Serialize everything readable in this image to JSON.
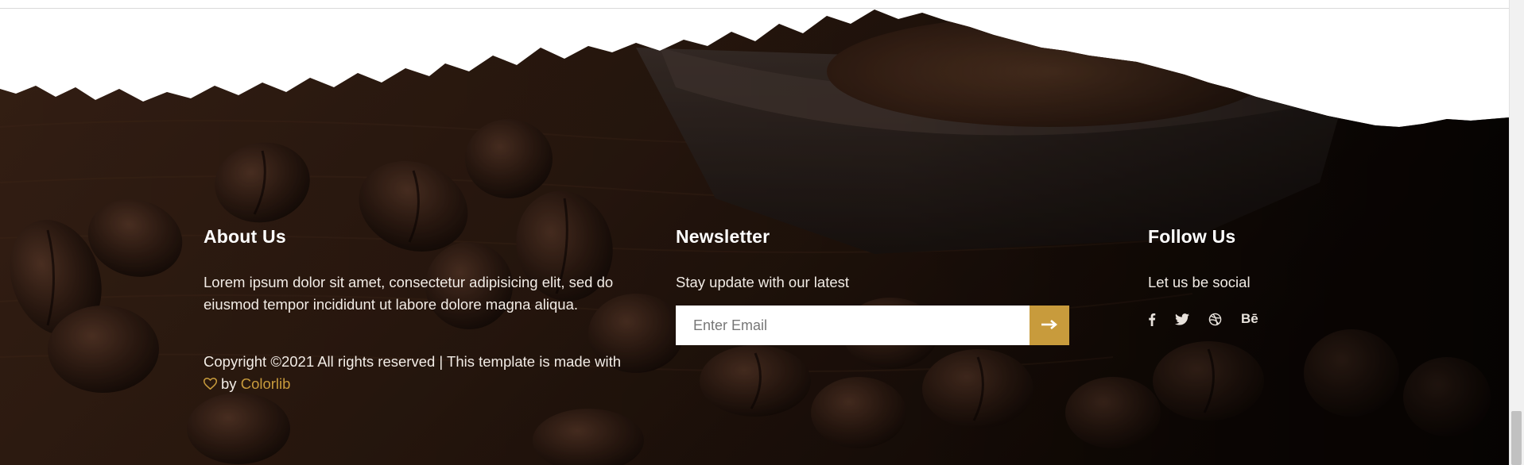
{
  "about": {
    "heading": "About Us",
    "text": "Lorem ipsum dolor sit amet, consectetur adipisicing elit, sed do eiusmod tempor incididunt ut labore dolore magna aliqua.",
    "copyright_prefix": "Copyright ©2021 All rights reserved | This template is made with",
    "by": "by",
    "brand": "Colorlib"
  },
  "newsletter": {
    "heading": "Newsletter",
    "text": "Stay update with our latest",
    "placeholder": "Enter Email"
  },
  "follow": {
    "heading": "Follow Us",
    "text": "Let us be social",
    "social_icons": [
      "facebook-icon",
      "twitter-icon",
      "dribbble-icon",
      "behance-icon"
    ],
    "behance_label": "Bē"
  },
  "colors": {
    "accent": "#c89b3c",
    "text": "#ffffff",
    "background": "#2a1a10"
  }
}
